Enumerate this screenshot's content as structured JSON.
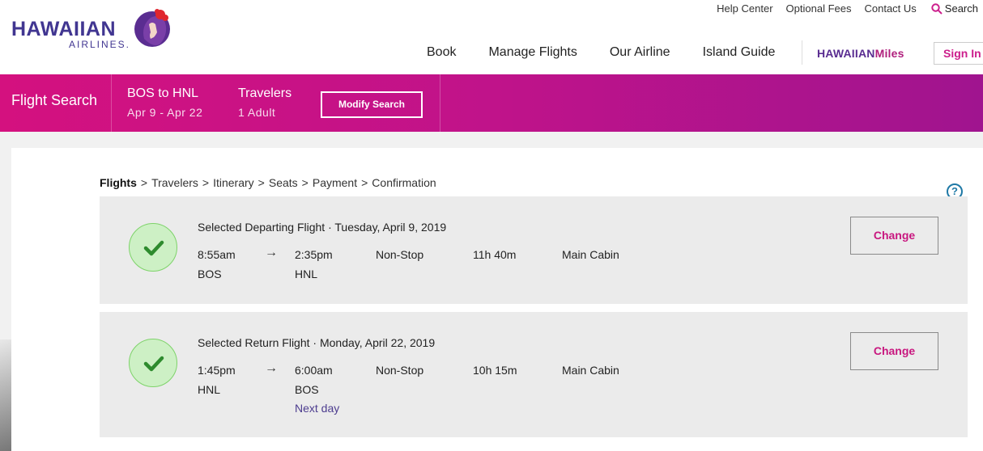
{
  "header": {
    "logo_word": "HAWAIIAN",
    "logo_sub": "AIRLINES.",
    "utility": {
      "help_center": "Help Center",
      "optional_fees": "Optional Fees",
      "contact_us": "Contact Us",
      "search": "Search"
    },
    "nav": {
      "book": "Book",
      "manage_flights": "Manage Flights",
      "our_airline": "Our Airline",
      "island_guide": "Island Guide"
    },
    "miles_brand_a": "HAWAIIAN",
    "miles_brand_b": "Miles",
    "sign_in": "Sign In"
  },
  "search_bar": {
    "title": "Flight Search",
    "route": "BOS to HNL",
    "dates": "Apr 9 - Apr 22",
    "travelers_label": "Travelers",
    "travelers_value": "1 Adult",
    "modify_button": "Modify Search"
  },
  "breadcrumb": {
    "flights": "Flights",
    "travelers": "Travelers",
    "itinerary": "Itinerary",
    "seats": "Seats",
    "payment": "Payment",
    "confirmation": "Confirmation",
    "sep": ">"
  },
  "help_icon": "?",
  "flights": [
    {
      "title": "Selected Departing Flight · Tuesday, April 9, 2019",
      "depart_time": "8:55am",
      "depart_code": "BOS",
      "arrive_time": "2:35pm",
      "arrive_code": "HNL",
      "arrow": "→",
      "stops": "Non-Stop",
      "duration": "11h 40m",
      "cabin": "Main Cabin",
      "change": "Change"
    },
    {
      "title": "Selected Return Flight · Monday, April 22, 2019",
      "depart_time": "1:45pm",
      "depart_code": "HNL",
      "arrive_time": "6:00am",
      "arrive_code": "BOS",
      "next_day": "Next day",
      "arrow": "→",
      "stops": "Non-Stop",
      "duration": "10h 15m",
      "cabin": "Main Cabin",
      "change": "Change"
    }
  ],
  "colors": {
    "brand_purple": "#413691",
    "brand_magenta": "#d4117f",
    "check_green": "#2e8b2e",
    "change_pink": "#c8177f"
  },
  "icons": {
    "search": "search-icon",
    "check": "checkmark-icon",
    "help": "help-icon",
    "logo": "hawaiian-airlines-logo"
  }
}
